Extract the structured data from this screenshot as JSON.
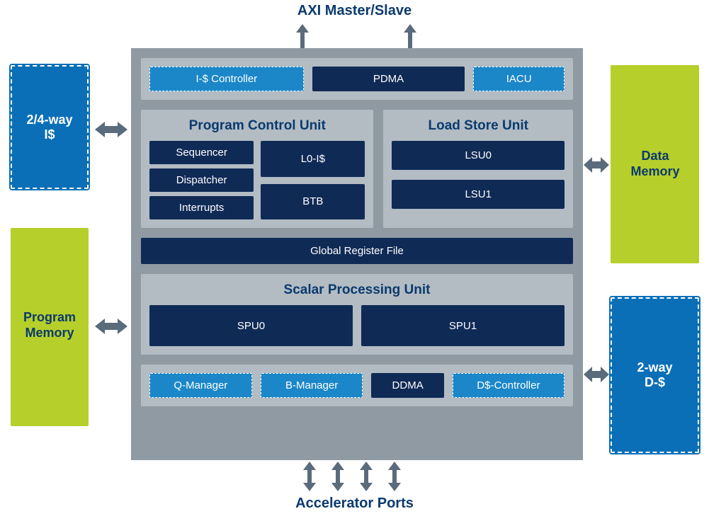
{
  "top_label": "AXI Master/Slave",
  "bottom_label": "Accelerator Ports",
  "left_top_box": "2/4-way\nI$",
  "left_bottom_box": "Program\nMemory",
  "right_top_box": "Data\nMemory",
  "right_bottom_box": "2-way\nD-$",
  "top_strip": {
    "icache_ctrl": "I-$ Controller",
    "pdma": "PDMA",
    "iacu": "IACU"
  },
  "pcu": {
    "title": "Program Control Unit",
    "sequencer": "Sequencer",
    "dispatcher": "Dispatcher",
    "interrupts": "Interrupts",
    "l0_is": "L0-I$",
    "btb": "BTB"
  },
  "lsu": {
    "title": "Load Store Unit",
    "lsu0": "LSU0",
    "lsu1": "LSU1"
  },
  "grf": "Global Register File",
  "spu": {
    "title": "Scalar Processing Unit",
    "spu0": "SPU0",
    "spu1": "SPU1"
  },
  "bottom_strip": {
    "qmgr": "Q-Manager",
    "bmgr": "B-Manager",
    "ddma": "DDMA",
    "dcache_ctrl": "D$-Controller"
  }
}
